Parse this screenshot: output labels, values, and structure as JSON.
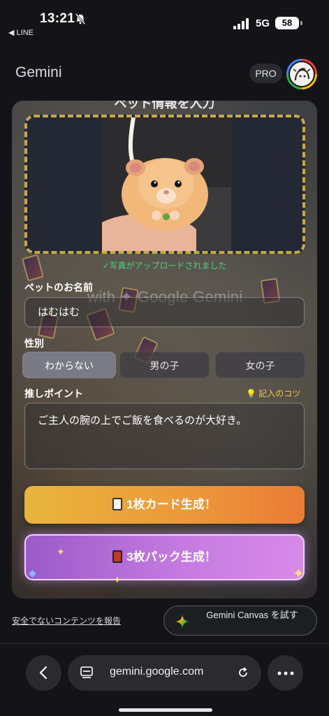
{
  "status_bar": {
    "time": "13:21",
    "back_app": "◀ LINE",
    "network": "5G",
    "battery": "58"
  },
  "header": {
    "title": "Gemini",
    "pro_badge": "PRO"
  },
  "canvas": {
    "heading": "ペット情報を入力",
    "watermark": "with ✦ Google Gemini",
    "upload_status": "✓写真がアップロードされました",
    "name_label": "ペットのお名前",
    "name_value": "はむはむ",
    "gender_label": "性別",
    "gender_options": [
      "わからない",
      "男の子",
      "女の子"
    ],
    "selected_gender": "わからない",
    "points_label": "推しポイント",
    "hint_link": "💡 記入のコツ",
    "points_value": "ご主人の腕の上でご飯を食べるのが大好き。",
    "btn_single": "1枚カード生成！",
    "btn_pack": "3枚パック生成！",
    "accent_colors": {
      "gold": "#c7a84a",
      "orange": "#ea7c36",
      "purple": "#c47ae0",
      "success": "#4fd07a"
    }
  },
  "footer": {
    "report_link": "安全でないコンテンツを報告",
    "canvas_button": "Gemini Canvas を試す"
  },
  "browser": {
    "url": "gemini.google.com"
  },
  "icons": [
    "bell-off-icon",
    "signal-icon",
    "back-arrow-icon",
    "tab-icon",
    "reload-icon",
    "more-icon",
    "gemini-sparkle-icon",
    "bulb-icon",
    "card-icon",
    "pack-icon"
  ]
}
